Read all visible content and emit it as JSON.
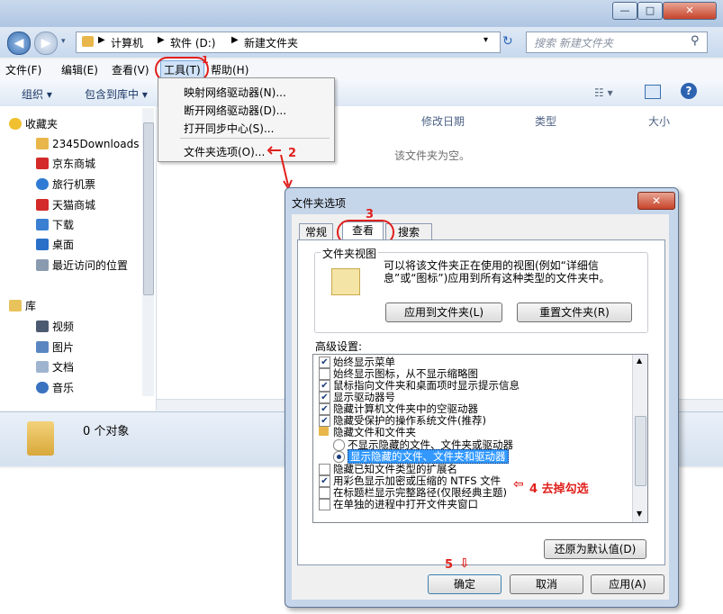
{
  "explorer": {
    "breadcrumb": [
      "计算机",
      "软件 (D:)",
      "新建文件夹"
    ],
    "search_placeholder": "搜索 新建文件夹",
    "menus": [
      "文件(F)",
      "编辑(E)",
      "查看(V)",
      "工具(T)",
      "帮助(H)"
    ],
    "toolbar": {
      "organize": "组织 ▾",
      "include": "包含到库中 ▾"
    },
    "nav": {
      "favorites": "收藏夹",
      "items": [
        "2345Downloads",
        "京东商城",
        "旅行机票",
        "天猫商城",
        "下载",
        "桌面",
        "最近访问的位置"
      ],
      "library": "库",
      "library_items": [
        "视频",
        "图片",
        "文档",
        "音乐"
      ]
    },
    "columns": [
      "修改日期",
      "类型",
      "大小"
    ],
    "empty_text": "该文件夹为空。",
    "status": "0 个对象"
  },
  "tools_menu": [
    "映射网络驱动器(N)...",
    "断开网络驱动器(D)...",
    "打开同步中心(S)...",
    "文件夹选项(O)..."
  ],
  "dialog": {
    "title": "文件夹选项",
    "tabs": [
      "常规",
      "查看",
      "搜索"
    ],
    "folder_views_label": "文件夹视图",
    "folder_views_desc": "可以将该文件夹正在使用的视图(例如“详细信息”或“图标”)应用到所有这种类型的文件夹中。",
    "apply_folders": "应用到文件夹(L)",
    "reset_folders": "重置文件夹(R)",
    "advanced_label": "高级设置:",
    "settings": [
      {
        "label": "始终显示菜单",
        "type": "check",
        "checked": true
      },
      {
        "label": "始终显示图标，从不显示缩略图",
        "type": "check",
        "checked": false
      },
      {
        "label": "鼠标指向文件夹和桌面项时显示提示信息",
        "type": "check",
        "checked": true
      },
      {
        "label": "显示驱动器号",
        "type": "check",
        "checked": true
      },
      {
        "label": "隐藏计算机文件夹中的空驱动器",
        "type": "check",
        "checked": true
      },
      {
        "label": "隐藏受保护的操作系统文件(推荐)",
        "type": "check",
        "checked": true
      },
      {
        "label": "隐藏文件和文件夹",
        "type": "folder",
        "checked": false
      },
      {
        "label": "不显示隐藏的文件、文件夹或驱动器",
        "type": "radio",
        "checked": false
      },
      {
        "label": "显示隐藏的文件、文件夹和驱动器",
        "type": "radio",
        "checked": true
      },
      {
        "label": "隐藏已知文件类型的扩展名",
        "type": "check",
        "checked": false
      },
      {
        "label": "用彩色显示加密或压缩的 NTFS 文件",
        "type": "check",
        "checked": true
      },
      {
        "label": "在标题栏显示完整路径(仅限经典主题)",
        "type": "check",
        "checked": false
      },
      {
        "label": "在单独的进程中打开文件夹窗口",
        "type": "check",
        "checked": false
      }
    ],
    "restore_defaults": "还原为默认值(D)",
    "ok": "确定",
    "cancel": "取消",
    "apply": "应用(A)"
  },
  "annotations": {
    "step2": "2",
    "step3": "3",
    "step4": "4 去掉勾选",
    "step5": "5"
  },
  "colors": {
    "accent_red": "#e0201c",
    "selection": "#3399ff"
  }
}
